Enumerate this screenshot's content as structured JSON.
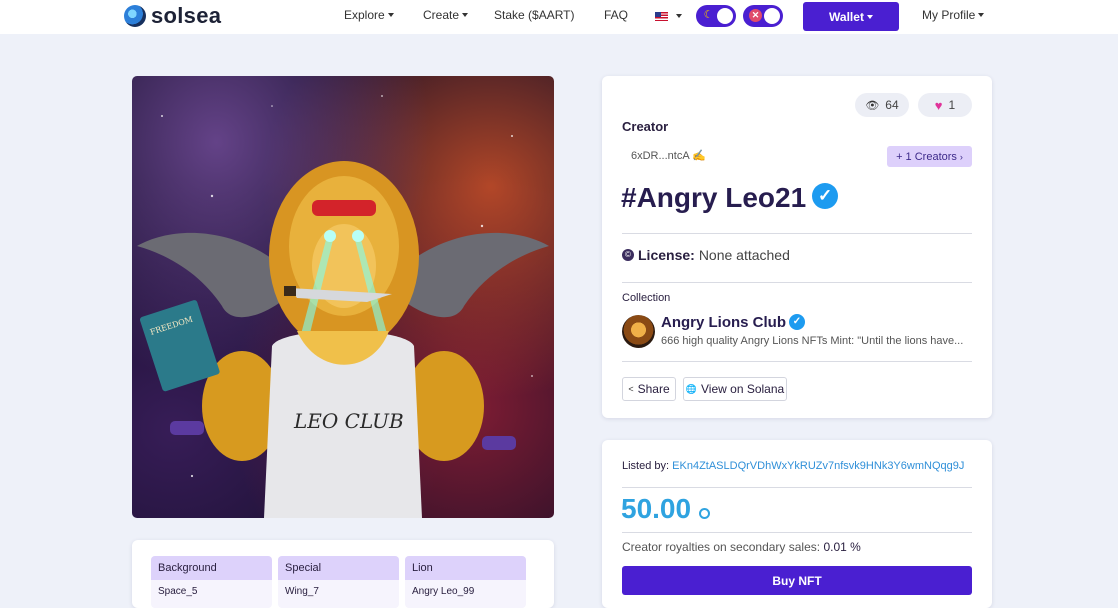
{
  "header": {
    "logo_text": "solsea",
    "nav": [
      {
        "label": "Explore"
      },
      {
        "label": "Create"
      },
      {
        "label": "Stake ($AART)"
      },
      {
        "label": "FAQ"
      }
    ],
    "wallet_label": "Wallet",
    "profile_label": "My Profile"
  },
  "nft": {
    "image_text": {
      "book": "FREEDOM",
      "shirt": "LEO CLUB"
    },
    "stats": {
      "views": "64",
      "likes": "1"
    },
    "creator_label": "Creator",
    "creator_address": "6xDR...ntcA",
    "creator_emoji": "✍",
    "more_creators": "+ 1 Creators",
    "title": "#Angry Leo21",
    "license_label": "License:",
    "license_value": "None attached",
    "collection_label": "Collection",
    "collection_name": "Angry Lions Club",
    "collection_desc": "666 high quality Angry Lions NFTs Mint: \"Until the lions have...",
    "share_label": "Share",
    "solana_label": "View on Solana"
  },
  "listing": {
    "listed_by_label": "Listed by:",
    "listed_by_address": "EKn4ZtASLDQrVDhWxYkRUZv7nfsvk9HNk3Y6wmNQqg9J",
    "price": "50.00",
    "royalties_label": "Creator royalties on secondary sales:",
    "royalties_value": "0.01 %",
    "buy_label": "Buy NFT"
  },
  "attributes": [
    {
      "trait": "Background",
      "value": "Space_5"
    },
    {
      "trait": "Special",
      "value": "Wing_7"
    },
    {
      "trait": "Lion",
      "value": "Angry Leo_99"
    }
  ]
}
